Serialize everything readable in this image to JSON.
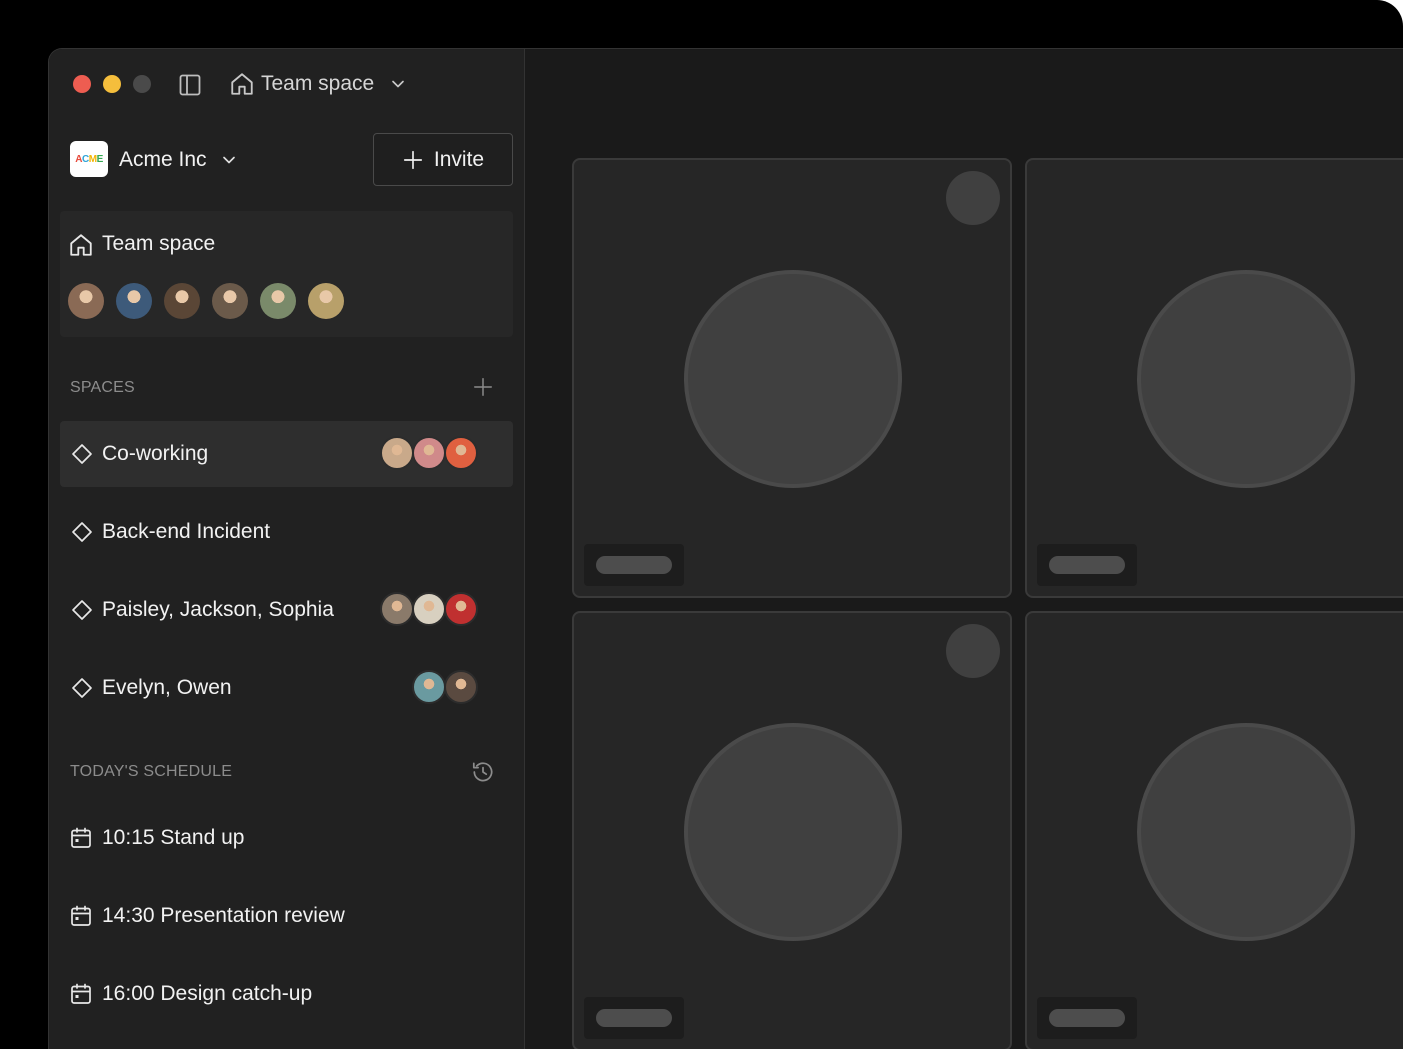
{
  "window": {
    "breadcrumb_title": "Team space"
  },
  "workspace": {
    "name": "Acme Inc",
    "logo_text": "ACME",
    "invite_label": "Invite"
  },
  "team_card": {
    "title": "Team space",
    "members": [
      {
        "name": "member-1",
        "color": "#8a6a55"
      },
      {
        "name": "member-2",
        "color": "#3d5a7a"
      },
      {
        "name": "member-3",
        "color": "#5a4636"
      },
      {
        "name": "member-4",
        "color": "#6b5a4a"
      },
      {
        "name": "member-5",
        "color": "#7a8a6a"
      },
      {
        "name": "member-6",
        "color": "#b8a06a"
      }
    ]
  },
  "spaces": {
    "label": "SPACES",
    "items": [
      {
        "label": "Co-working",
        "active": true,
        "avatars": [
          "#c9a98a",
          "#d08a8a",
          "#e06040"
        ]
      },
      {
        "label": "Back-end Incident",
        "active": false,
        "avatars": []
      },
      {
        "label": "Paisley, Jackson, Sophia",
        "active": false,
        "avatars": [
          "#8a7a6a",
          "#d8d0c0",
          "#c03030"
        ]
      },
      {
        "label": "Evelyn, Owen",
        "active": false,
        "avatars": [
          "#6a9aa0",
          "#5a4a40"
        ]
      }
    ]
  },
  "schedule": {
    "label": "TODAY'S SCHEDULE",
    "items": [
      {
        "label": "10:15 Stand up"
      },
      {
        "label": "14:30 Presentation review"
      },
      {
        "label": "16:00 Design catch-up"
      }
    ]
  },
  "colors": {
    "traffic_red": "#ee5d51",
    "traffic_yellow": "#f5be3c",
    "traffic_gray": "#4a4a4a"
  }
}
